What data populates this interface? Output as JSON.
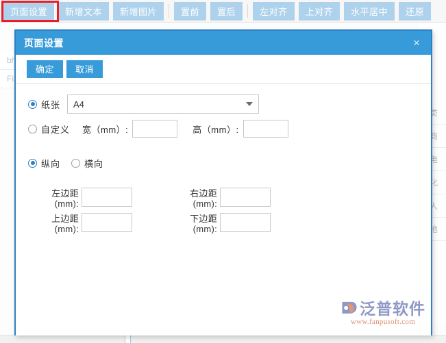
{
  "toolbar": {
    "buttons": [
      {
        "label": "页面设置",
        "highlighted": true
      },
      {
        "label": "新增文本",
        "highlighted": false
      },
      {
        "label": "新增图片",
        "highlighted": false
      },
      {
        "label": "置前",
        "highlighted": false
      },
      {
        "label": "置后",
        "highlighted": false
      },
      {
        "label": "左对齐",
        "highlighted": false
      },
      {
        "label": "上对齐",
        "highlighted": false
      },
      {
        "label": "水平居中",
        "highlighted": false
      },
      {
        "label": "还原",
        "highlighted": false
      }
    ]
  },
  "background": {
    "left_cells": [
      "bh",
      "Fix"
    ],
    "right_cells": [
      "构类",
      "应商",
      "系电",
      "种化",
      "单人",
      "货地"
    ]
  },
  "dialog": {
    "title": "页面设置",
    "close_icon": "×",
    "actions": {
      "confirm_label": "确定",
      "cancel_label": "取消"
    },
    "paper": {
      "radio_label": "纸张",
      "selected": true,
      "select_value": "A4"
    },
    "custom": {
      "radio_label": "自定义",
      "selected": false,
      "width_label": "宽（mm）:",
      "width_value": "",
      "height_label": "高（mm）:",
      "height_value": ""
    },
    "orientation": {
      "portrait_label": "纵向",
      "portrait_selected": true,
      "landscape_label": "横向",
      "landscape_selected": false
    },
    "margins": [
      {
        "name": "left",
        "label_line1": "左边距",
        "label_line2": "(mm):",
        "value": ""
      },
      {
        "name": "right",
        "label_line1": "右边距",
        "label_line2": "(mm):",
        "value": ""
      },
      {
        "name": "top",
        "label_line1": "上边距",
        "label_line2": "(mm):",
        "value": ""
      },
      {
        "name": "bottom",
        "label_line1": "下边距",
        "label_line2": "(mm):",
        "value": ""
      }
    ]
  },
  "watermark": {
    "brand": "泛普软件",
    "url": "www.fanpusoft.com"
  },
  "colors": {
    "toolbar_button": "#aed2ec",
    "dialog_header": "#389bd9",
    "dialog_border": "#2d80c4",
    "highlight_box": "#ee1c25",
    "accent": "#2d80c4"
  }
}
